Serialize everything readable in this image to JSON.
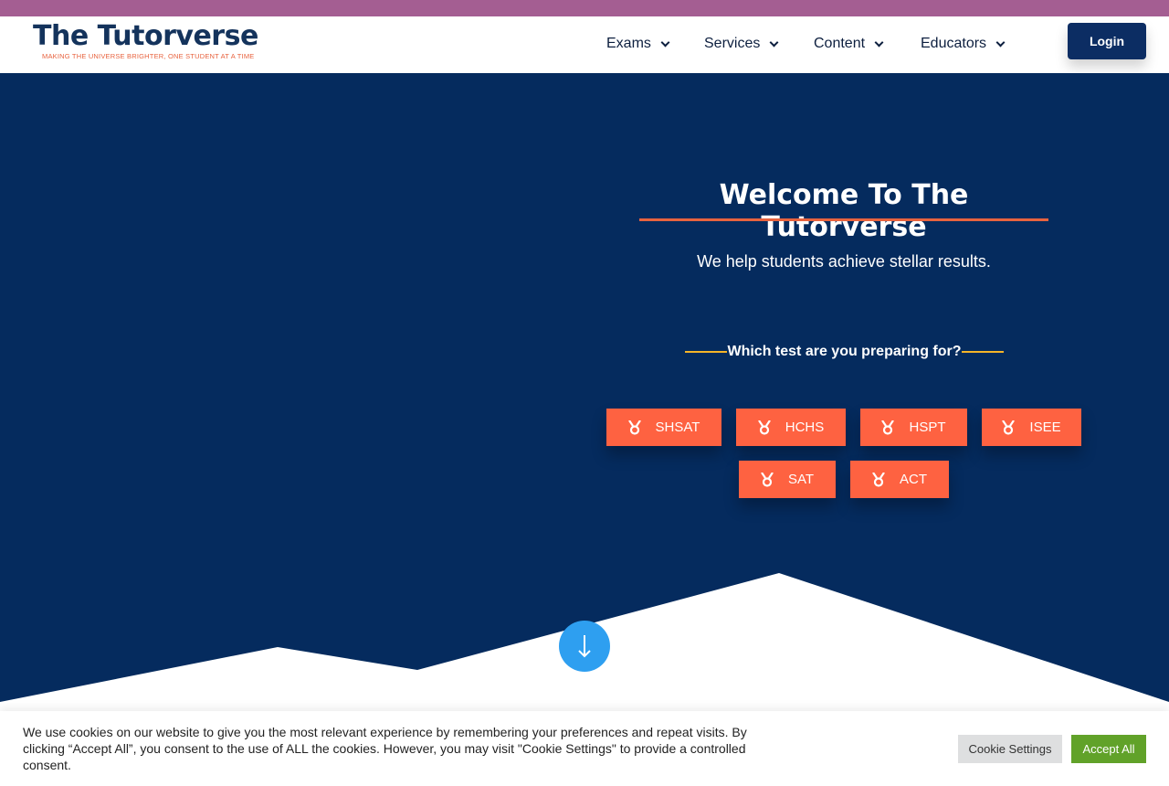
{
  "header": {
    "logo_title": "The Tutorverse",
    "logo_tagline": "Making the universe brighter, one student at a time",
    "nav": [
      {
        "label": "Exams"
      },
      {
        "label": "Services"
      },
      {
        "label": "Content"
      },
      {
        "label": "Educators"
      }
    ],
    "login_label": "Login"
  },
  "hero": {
    "title": "Welcome To The Tutorverse",
    "subtitle": "We help students achieve stellar results.",
    "prompt": "Which test are you preparing for?",
    "tests": [
      {
        "label": "SHSAT",
        "icon": "medal-icon"
      },
      {
        "label": "HCHS",
        "icon": "medal-icon"
      },
      {
        "label": "HSPT",
        "icon": "medal-icon"
      },
      {
        "label": "ISEE",
        "icon": "medal-icon"
      },
      {
        "label": "SAT",
        "icon": "medal-icon"
      },
      {
        "label": "ACT",
        "icon": "medal-icon"
      }
    ],
    "scroll_icon": "arrow-down-icon"
  },
  "cookie": {
    "message": "We use cookies on our website to give you the most relevant experience by remembering your preferences and repeat visits. By clicking “Accept All”, you consent to the use of ALL the cookies. However, you may visit \"Cookie Settings\" to provide a controlled consent.",
    "settings_label": "Cookie Settings",
    "accept_label": "Accept All"
  },
  "colors": {
    "hero_bg": "#052b5e",
    "accent_orange": "#fe6241",
    "accent_yellow": "#f5b528",
    "top_strip": "#a45e92",
    "login_bg": "#0c2d63",
    "scroll_button": "#2e9ff0",
    "accept_green": "#61a229"
  }
}
